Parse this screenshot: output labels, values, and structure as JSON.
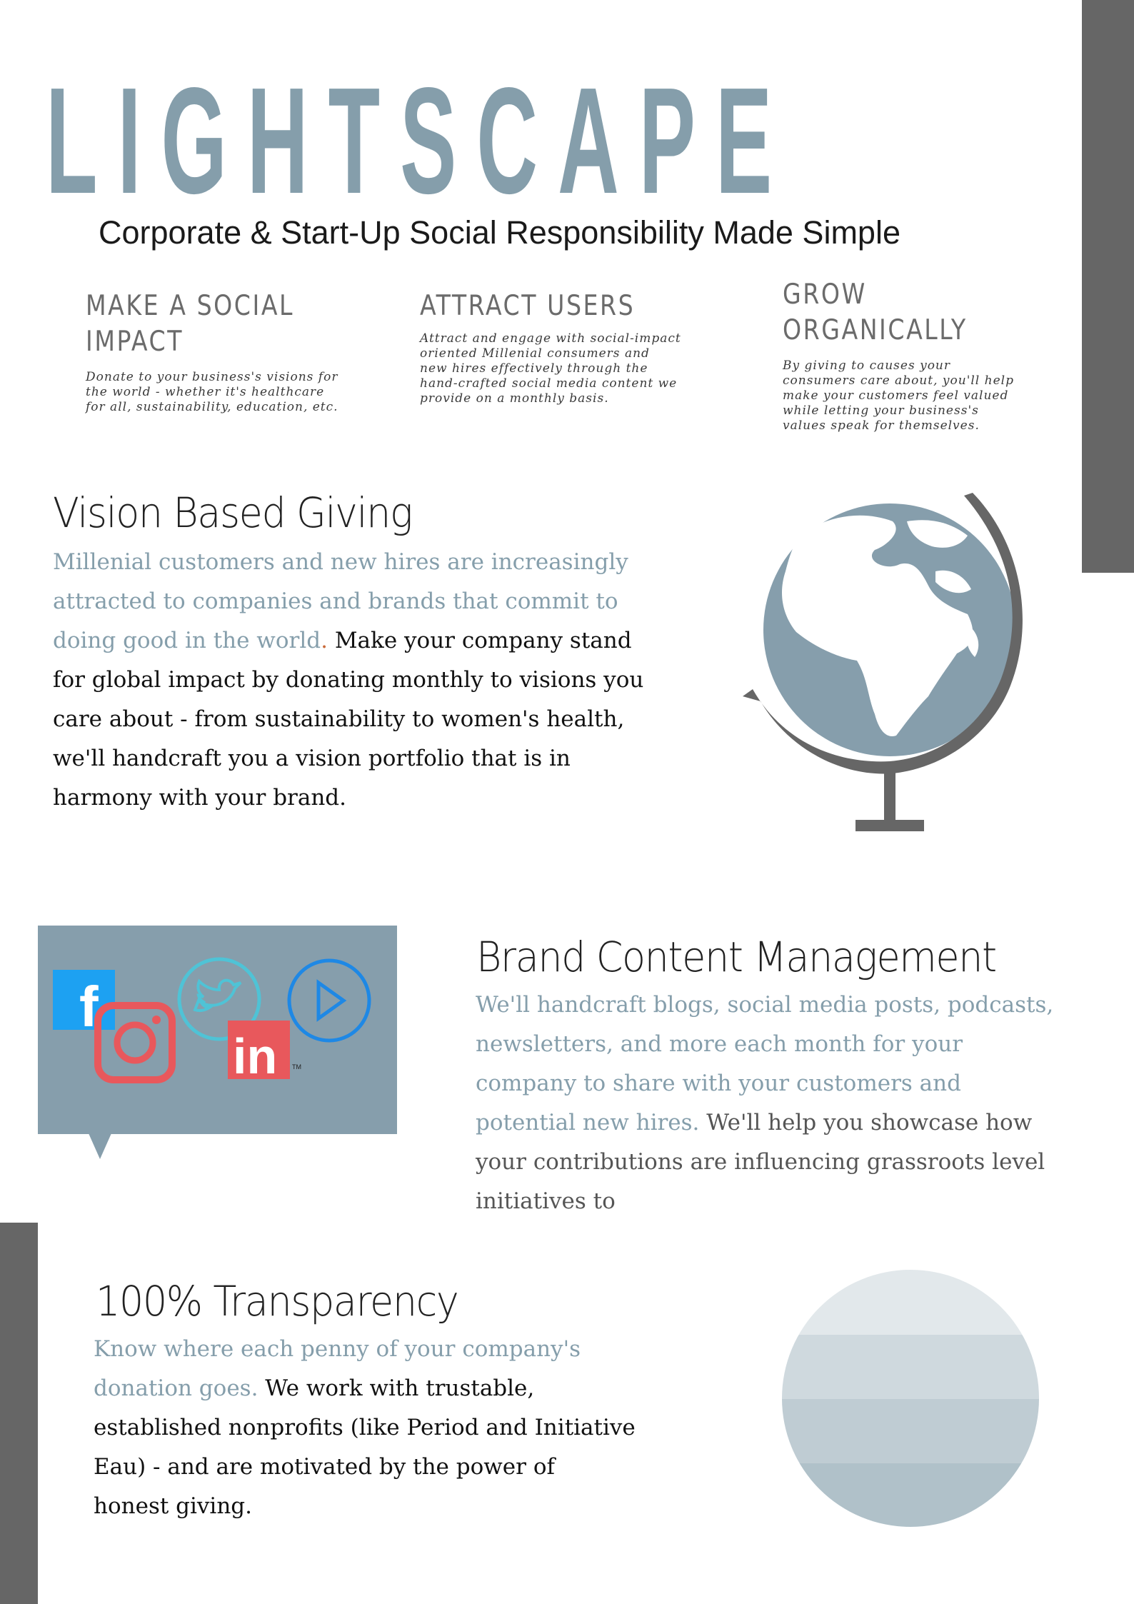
{
  "brand": {
    "name": "LIGHTSCAPE",
    "tagline": "Corporate & Start-Up Social Responsibility Made Simple"
  },
  "features": [
    {
      "title": "MAKE A SOCIAL IMPACT",
      "text": "Donate to your business's visions for the world - whether it's healthcare for all, sustainability, education, etc."
    },
    {
      "title": "ATTRACT USERS",
      "text": "Attract and engage with social-impact oriented Millenial consumers and new hires effectively through the hand-crafted social media content we provide on a monthly basis."
    },
    {
      "title": "GROW ORGANICALLY",
      "text": "By giving to causes your consumers care about, you'll help make your customers feel valued while letting your business's values speak for themselves."
    }
  ],
  "sections": {
    "vision": {
      "title": "Vision Based Giving",
      "highlight": "Millenial customers and new hires are increasingly attracted to companies and brands that commit to doing good in the world",
      "highlight_end": ".",
      "body": "Make your company stand for global impact by donating monthly to visions you care about - from sustainability to women's health, we'll handcraft you a vision portfolio that is in harmony with your brand."
    },
    "brand_content": {
      "title": "Brand Content Management",
      "highlight": "We'll handcraft blogs, social media posts, podcasts, newsletters, and more each month for your company to share with your customers and potential new hires.",
      "body": " We'll help you showcase how your contributions are influencing grassroots level initiatives to"
    },
    "transparency": {
      "title": "100% Transparency",
      "highlight": "Know where each penny of your company's donation goes.",
      "body": " We work with trustable, established nonprofits (like Period and Initiative Eau) - and are motivated by the power of honest giving."
    }
  },
  "social_icons": {
    "facebook_glyph": "f",
    "linkedin_glyph": "in",
    "trademark": "TM"
  },
  "colors": {
    "accent": "#859eab",
    "side_bar": "#666666",
    "facebook": "#1da1f2",
    "twitter": "#4fc3d6",
    "instagram": "#e8585c",
    "linkedin": "#e8585c",
    "play": "#1e88e5"
  }
}
